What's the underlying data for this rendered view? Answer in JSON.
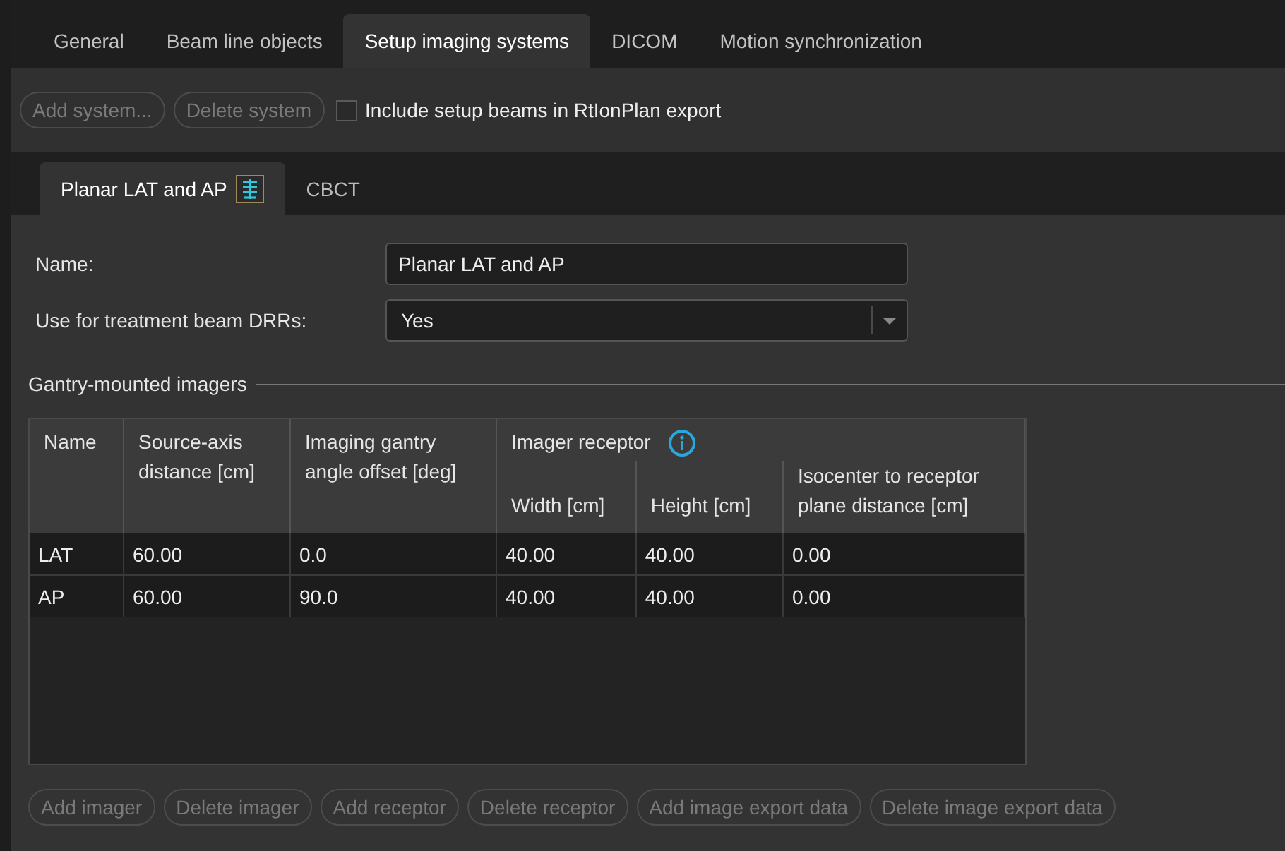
{
  "tabs": [
    {
      "label": "General",
      "selected": false
    },
    {
      "label": "Beam line objects",
      "selected": false
    },
    {
      "label": "Setup imaging systems",
      "selected": true
    },
    {
      "label": "DICOM",
      "selected": false
    },
    {
      "label": "Motion synchronization",
      "selected": false
    }
  ],
  "toolbar": {
    "buttons": [
      {
        "label": "Add system...",
        "disabled": true
      },
      {
        "label": "Delete system",
        "disabled": true
      }
    ],
    "checkbox": {
      "label": "Include setup beams in RtIonPlan export",
      "checked": false
    }
  },
  "system_tabs": [
    {
      "label": "Planar LAT and AP",
      "selected": true,
      "icon": true
    },
    {
      "label": "CBCT",
      "selected": false,
      "icon": false
    }
  ],
  "form": [
    {
      "kind": "text",
      "label": "Name:",
      "value": "Planar LAT and AP"
    },
    {
      "kind": "dropdown",
      "label": "Use for treatment beam DRRs:",
      "value": "Yes"
    }
  ],
  "group_title": "Gantry-mounted imagers",
  "table": {
    "columns": [
      "Name",
      "Source-axis distance [cm]",
      "Imaging gantry angle offset [deg]"
    ],
    "column_group": {
      "label": "Imager receptor",
      "columns": [
        "Width [cm]",
        "Height [cm]",
        "Isocenter to receptor plane distance [cm]"
      ]
    },
    "rows": [
      [
        "LAT",
        "60.00",
        "0.0",
        "40.00",
        "40.00",
        "0.00"
      ],
      [
        "AP",
        "60.00",
        "90.0",
        "40.00",
        "40.00",
        "0.00"
      ]
    ]
  },
  "buttons": [
    {
      "label": "Add imager",
      "disabled": true
    },
    {
      "label": "Delete imager",
      "disabled": true
    },
    {
      "label": "Add receptor",
      "disabled": true
    },
    {
      "label": "Delete receptor",
      "disabled": true
    },
    {
      "label": "Add image export data",
      "disabled": true
    },
    {
      "label": "Delete image export data",
      "disabled": true
    }
  ]
}
